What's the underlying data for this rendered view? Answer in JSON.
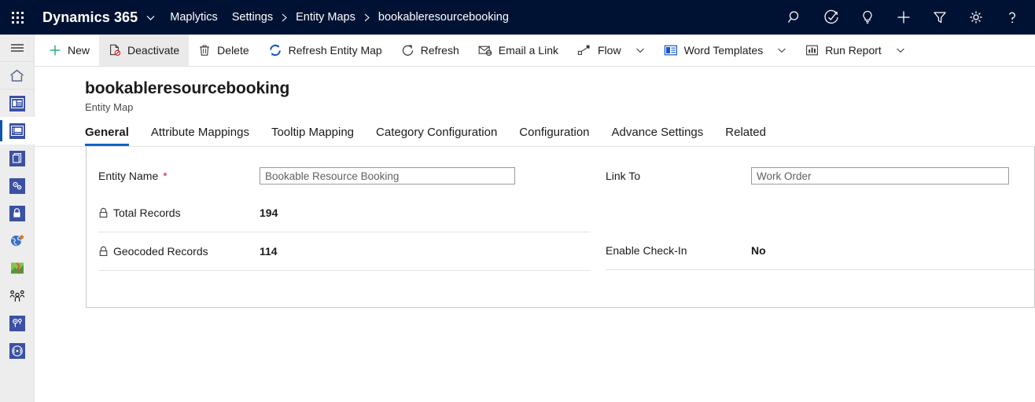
{
  "topnav": {
    "waffle_icon": "app-launcher-icon",
    "brand": "Dynamics 365",
    "brand_caret_icon": "chevron-down-icon",
    "app_name": "Maplytics",
    "breadcrumbs": [
      {
        "label": "Settings"
      },
      {
        "label": "Entity Maps"
      },
      {
        "label": "bookableresourcebooking"
      }
    ],
    "breadcrumb_separator_icon": "chevron-right-icon",
    "icons": [
      {
        "name": "search-icon",
        "label": "Search"
      },
      {
        "name": "assistant-icon",
        "label": "Assistant"
      },
      {
        "name": "lightbulb-icon",
        "label": "Ideas"
      },
      {
        "name": "plus-icon",
        "label": "Quick Create"
      },
      {
        "name": "filter-icon",
        "label": "Filter"
      },
      {
        "name": "gear-icon",
        "label": "Settings"
      },
      {
        "name": "help-icon",
        "label": "Help"
      }
    ],
    "background": "#001233"
  },
  "rail": {
    "background": "#ededed",
    "active_indicator_color": "#0f53b5",
    "items": [
      {
        "name": "hamburger-icon",
        "label": "Site Map",
        "active": false
      },
      {
        "name": "home-icon",
        "label": "Home",
        "active": false
      },
      {
        "name": "dashboard-icon",
        "label": "Dashboards",
        "active": false
      },
      {
        "name": "entity-maps-icon",
        "label": "Entity Maps",
        "active": true
      },
      {
        "name": "document-icon",
        "label": "Templates",
        "active": false
      },
      {
        "name": "settings-gears-icon",
        "label": "Configuration",
        "active": false
      },
      {
        "name": "lock-icon",
        "label": "Security",
        "active": false
      },
      {
        "name": "globe-icon",
        "label": "Geocoding",
        "active": false
      },
      {
        "name": "map-icon",
        "label": "Territories",
        "active": false
      },
      {
        "name": "users-icon",
        "label": "Users",
        "active": false
      },
      {
        "name": "location-pin-icon",
        "label": "Locations",
        "active": false
      },
      {
        "name": "radar-icon",
        "label": "Tracking",
        "active": false
      }
    ]
  },
  "commandbar": {
    "items": [
      {
        "label": "New",
        "icon": "plus-icon",
        "has_caret": false,
        "hover": false
      },
      {
        "label": "Deactivate",
        "icon": "deactivate-icon",
        "has_caret": false,
        "hover": true
      },
      {
        "label": "Delete",
        "icon": "trash-icon",
        "has_caret": false,
        "hover": false
      },
      {
        "label": "Refresh Entity Map",
        "icon": "sync-icon",
        "has_caret": false,
        "hover": false
      },
      {
        "label": "Refresh",
        "icon": "refresh-icon",
        "has_caret": false,
        "hover": false
      },
      {
        "label": "Email a Link",
        "icon": "email-link-icon",
        "has_caret": false,
        "hover": false
      },
      {
        "label": "Flow",
        "icon": "flow-icon",
        "has_caret": true,
        "hover": false
      },
      {
        "label": "Word Templates",
        "icon": "word-template-icon",
        "has_caret": true,
        "hover": false
      },
      {
        "label": "Run Report",
        "icon": "report-icon",
        "has_caret": true,
        "hover": false
      }
    ]
  },
  "page": {
    "title": "bookableresourcebooking",
    "subtitle": "Entity Map"
  },
  "tabs": {
    "active_color": "#1264c8",
    "items": [
      {
        "label": "General",
        "active": true
      },
      {
        "label": "Attribute Mappings",
        "active": false
      },
      {
        "label": "Tooltip Mapping",
        "active": false
      },
      {
        "label": "Category Configuration",
        "active": false
      },
      {
        "label": "Configuration",
        "active": false
      },
      {
        "label": "Advance Settings",
        "active": false
      },
      {
        "label": "Related",
        "active": false
      }
    ]
  },
  "form": {
    "entity_name": {
      "label": "Entity Name",
      "required_marker": "*",
      "required_color": "#e00b3f",
      "value": "Bookable Resource Booking"
    },
    "link_to": {
      "label": "Link To",
      "value": "Work Order"
    },
    "total_records": {
      "label": "Total Records",
      "value": "194",
      "lock_icon": "lock-icon"
    },
    "geocoded_records": {
      "label": "Geocoded Records",
      "value": "114",
      "lock_icon": "lock-icon"
    },
    "enable_checkin": {
      "label": "Enable Check-In",
      "value": "No"
    }
  }
}
